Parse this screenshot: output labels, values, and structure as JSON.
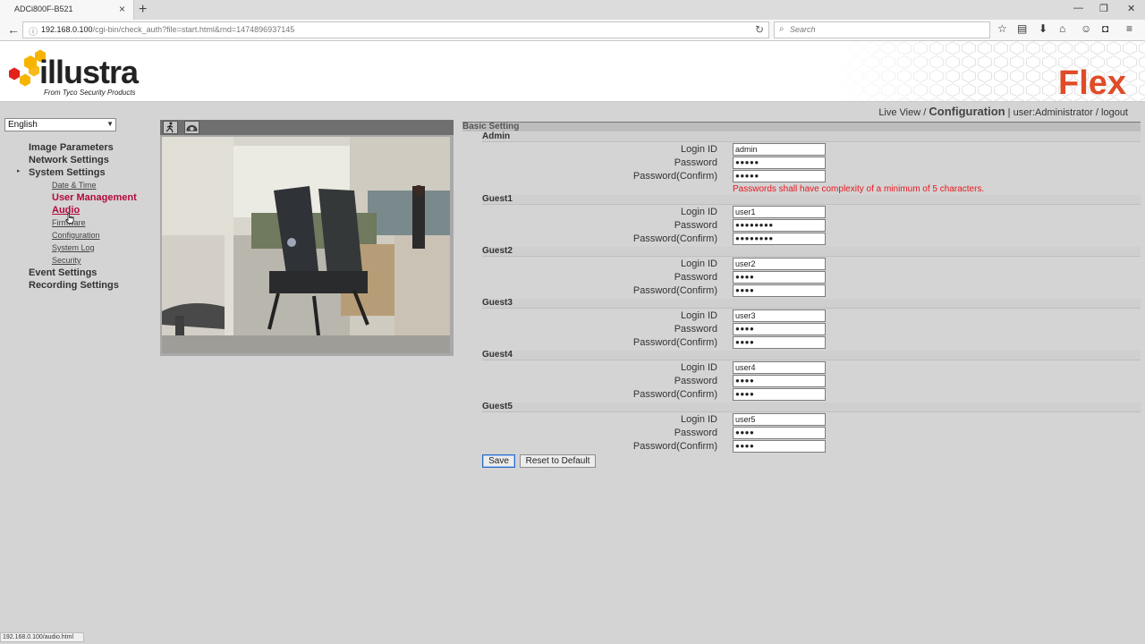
{
  "browser": {
    "tab_title": "ADCi800F-B521",
    "tab_close": "×",
    "new_tab": "+",
    "url_host": "192.168.0.100",
    "url_path": "/cgi-bin/check_auth?file=start.html&rnd=1474896937145",
    "search_placeholder": "Search",
    "status_url": "192.168.0.100/audio.html"
  },
  "header": {
    "logo_text": "illustra",
    "logo_subtitle": "From Tyco Security Products",
    "brand_right": "Flex",
    "brand_color": "#e04b28"
  },
  "userline": {
    "live_view": "Live View",
    "separator1": " / ",
    "configuration": "Configuration",
    "separator2": " | ",
    "user": "user:Administrator",
    "separator3": " / ",
    "logout": "logout"
  },
  "language": {
    "selected": "English"
  },
  "menu": {
    "image_parameters": "Image Parameters",
    "network_settings": "Network Settings",
    "system_settings": "System Settings",
    "date_time": "Date & Time",
    "user_management": "User Management",
    "audio": "Audio",
    "firmware": "Firmware",
    "configuration": "Configuration",
    "system_log": "System Log",
    "security": "Security",
    "event_settings": "Event Settings",
    "recording_settings": "Recording Settings",
    "active_color": "#b20a3c"
  },
  "form": {
    "section_title": "Basic Setting",
    "labels": {
      "login_id": "Login ID",
      "password": "Password",
      "password_confirm": "Password(Confirm)"
    },
    "admin": {
      "title": "Admin",
      "login_id": "admin",
      "password": "●●●●●",
      "password_confirm": "●●●●●"
    },
    "error": "Passwords shall have complexity of a minimum of 5 characters.",
    "guest1": {
      "title": "Guest1",
      "login_id": "user1",
      "password": "●●●●●●●●",
      "password_confirm": "●●●●●●●●"
    },
    "guest2": {
      "title": "Guest2",
      "login_id": "user2",
      "password": "●●●●",
      "password_confirm": "●●●●"
    },
    "guest3": {
      "title": "Guest3",
      "login_id": "user3",
      "password": "●●●●",
      "password_confirm": "●●●●"
    },
    "guest4": {
      "title": "Guest4",
      "login_id": "user4",
      "password": "●●●●",
      "password_confirm": "●●●●"
    },
    "guest5": {
      "title": "Guest5",
      "login_id": "user5",
      "password": "●●●●",
      "password_confirm": "●●●●"
    },
    "save_label": "Save",
    "reset_label": "Reset to Default",
    "error_color": "#e8171e"
  }
}
